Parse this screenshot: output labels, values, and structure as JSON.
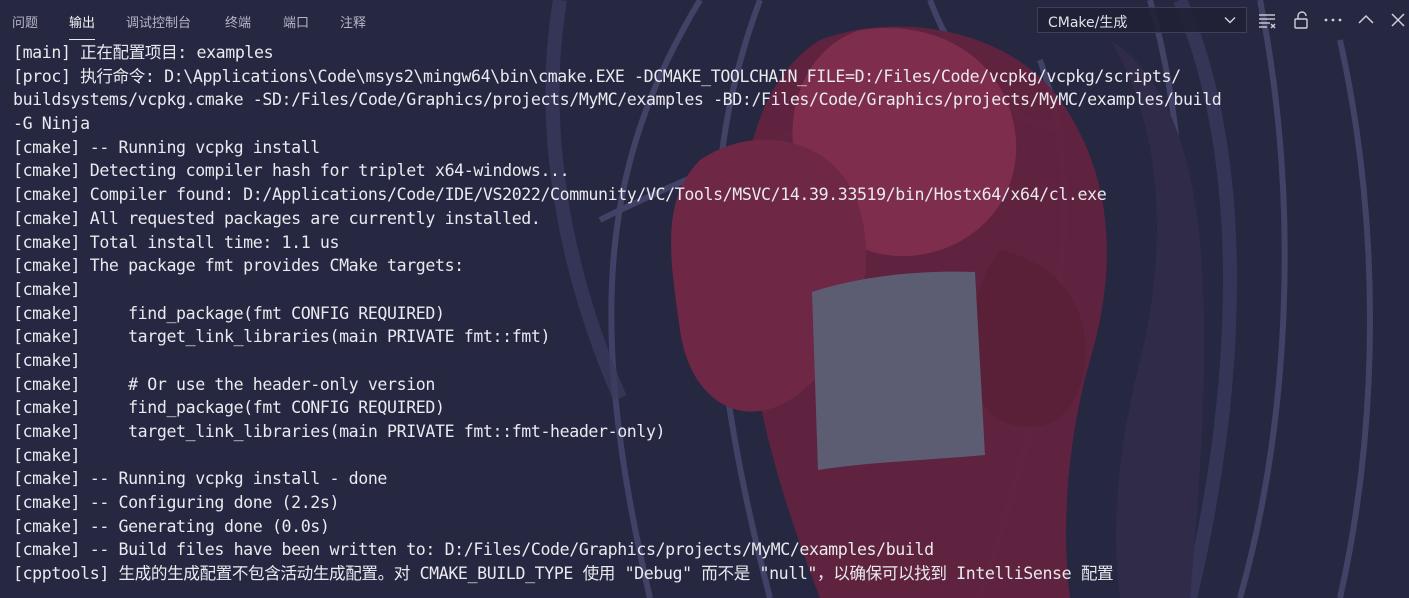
{
  "panel": {
    "tabs": [
      {
        "label": "问题"
      },
      {
        "label": "输出"
      },
      {
        "label": "调试控制台"
      },
      {
        "label": "终端"
      },
      {
        "label": "端口"
      },
      {
        "label": "注释"
      }
    ],
    "active_tab": "输出",
    "channel_select": {
      "value": "CMake/生成"
    },
    "tools": [
      "filter-list-icon",
      "lock-icon",
      "more-icon",
      "chevron-up-icon",
      "close-icon"
    ]
  },
  "output": {
    "lines": [
      "[main] 正在配置项目: examples",
      "[proc] 执行命令: D:\\Applications\\Code\\msys2\\mingw64\\bin\\cmake.EXE -DCMAKE_TOOLCHAIN_FILE=D:/Files/Code/vcpkg/vcpkg/scripts/",
      "buildsystems/vcpkg.cmake -SD:/Files/Code/Graphics/projects/MyMC/examples -BD:/Files/Code/Graphics/projects/MyMC/examples/build",
      "-G Ninja",
      "[cmake] -- Running vcpkg install",
      "[cmake] Detecting compiler hash for triplet x64-windows...",
      "[cmake] Compiler found: D:/Applications/Code/IDE/VS2022/Community/VC/Tools/MSVC/14.39.33519/bin/Hostx64/x64/cl.exe",
      "[cmake] All requested packages are currently installed.",
      "[cmake] Total install time: 1.1 us",
      "[cmake] The package fmt provides CMake targets:",
      "[cmake]",
      "[cmake]     find_package(fmt CONFIG REQUIRED)",
      "[cmake]     target_link_libraries(main PRIVATE fmt::fmt)",
      "[cmake]",
      "[cmake]     # Or use the header-only version",
      "[cmake]     find_package(fmt CONFIG REQUIRED)",
      "[cmake]     target_link_libraries(main PRIVATE fmt::fmt-header-only)",
      "[cmake]",
      "[cmake] -- Running vcpkg install - done",
      "[cmake] -- Configuring done (2.2s)",
      "[cmake] -- Generating done (0.0s)",
      "[cmake] -- Build files have been written to: D:/Files/Code/Graphics/projects/MyMC/examples/build",
      "[cpptools] 生成的生成配置不包含活动生成配置。对 CMAKE_BUILD_TYPE 使用 \"Debug\" 而不是 \"null\"，以确保可以找到 IntelliSense 配置"
    ]
  },
  "colors": {
    "background": "#262740",
    "text": "#e9e9ef",
    "artwork_red": "#7e2e4c",
    "artwork_gray": "#5a5b70",
    "artwork_outline": "#46476a"
  }
}
